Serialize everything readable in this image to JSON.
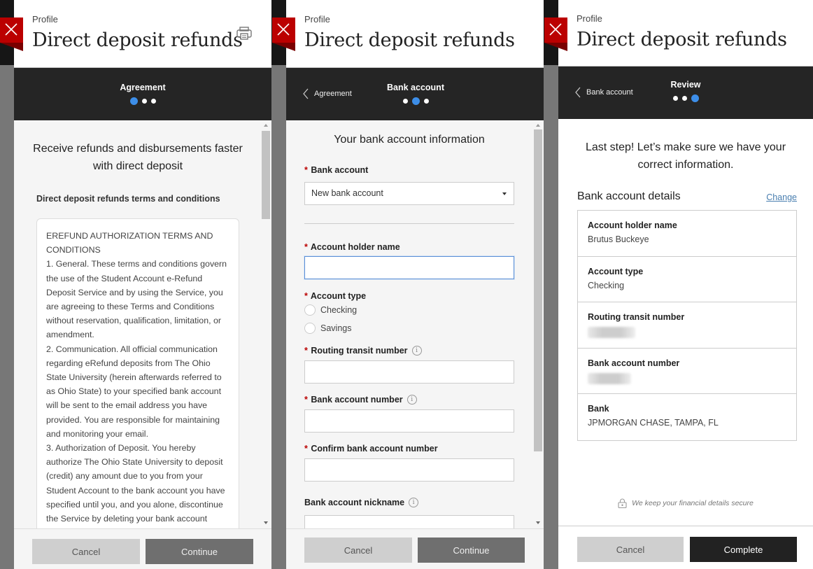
{
  "common": {
    "breadcrumb": "Profile",
    "title": "Direct deposit refunds",
    "cancel_label": "Cancel"
  },
  "colors": {
    "brand_red": "#bb0000",
    "step_active": "#3d8ee8",
    "step_bar": "#252525"
  },
  "screens": [
    {
      "step_label": "Agreement",
      "step_index": 1,
      "step_total": 3,
      "heading": "Receive refunds and disbursements faster with direct deposit",
      "subheading": "Direct deposit refunds terms and conditions",
      "terms_text": "EREFUND AUTHORIZATION TERMS AND CONDITIONS\n1. General. These terms and conditions govern the use of the Student Account e-Refund Deposit Service and by using the Service, you are agreeing to these Terms and Conditions without reservation, qualification, limitation, or amendment.\n2. Communication. All official communication regarding eRefund deposits from The Ohio State University (herein afterwards referred to as Ohio State) to your specified bank account will be sent to the email address you have provided. You are responsible for maintaining and monitoring your email.\n3. Authorization of Deposit. You hereby authorize The Ohio State University to deposit (credit) any amount due to you from your Student Account to the bank account you have specified until you, and you alone, discontinue the Service by deleting your bank account information...",
      "primary_label": "Continue"
    },
    {
      "back_label": "Agreement",
      "step_label": "Bank account",
      "step_index": 2,
      "step_total": 3,
      "form_title": "Your bank account information",
      "fields": {
        "bank_account": {
          "label": "Bank account",
          "required": "*",
          "value": "New bank account"
        },
        "holder_name": {
          "label": "Account holder name",
          "required": "*",
          "value": ""
        },
        "account_type": {
          "label": "Account type",
          "required": "*",
          "options": [
            "Checking",
            "Savings"
          ],
          "selected": ""
        },
        "routing": {
          "label": "Routing transit number",
          "required": "*",
          "value": ""
        },
        "account_number": {
          "label": "Bank account number",
          "required": "*",
          "value": ""
        },
        "confirm_number": {
          "label": "Confirm bank account number",
          "required": "*",
          "value": ""
        },
        "nickname": {
          "label": "Bank account nickname",
          "value": ""
        }
      },
      "info_glyph": "i",
      "primary_label": "Continue"
    },
    {
      "back_label": "Bank account",
      "step_label": "Review",
      "step_index": 3,
      "step_total": 3,
      "heading": "Last step! Let’s make sure we have your correct information.",
      "details_title": "Bank account details",
      "change_label": "Change",
      "details": [
        {
          "label": "Account holder name",
          "value": "Brutus Buckeye"
        },
        {
          "label": "Account type",
          "value": "Checking"
        },
        {
          "label": "Routing transit number",
          "value": null,
          "redacted": true
        },
        {
          "label": "Bank account number",
          "value": null,
          "redacted": true
        },
        {
          "label": "Bank",
          "value": "JPMORGAN CHASE, TAMPA, FL"
        }
      ],
      "secure_note": "We keep your financial details secure",
      "primary_label": "Complete"
    }
  ]
}
